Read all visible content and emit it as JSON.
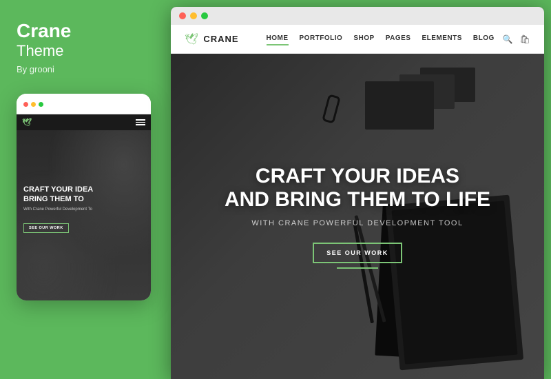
{
  "sidebar": {
    "title": "Crane",
    "subtitle": "Theme",
    "by": "By grooni"
  },
  "mobile": {
    "logo": "🕊",
    "hero_title_line1": "CRAFT YOUR IDEA",
    "hero_title_line2": "BRING THEM TO",
    "hero_sub": "With Crane Powerful Development To",
    "cta": "SEE OUR WORK"
  },
  "desktop": {
    "logo_text": "CRANE",
    "nav": {
      "items": [
        {
          "label": "HOME",
          "active": true
        },
        {
          "label": "PORTFOLIO",
          "active": false
        },
        {
          "label": "SHOP",
          "active": false
        },
        {
          "label": "PAGES",
          "active": false
        },
        {
          "label": "ELEMENTS",
          "active": false
        },
        {
          "label": "BLOG",
          "active": false
        }
      ]
    },
    "hero": {
      "title_line1": "CRAFT YOUR IDEAS",
      "title_line2": "AND BRING THEM TO LIFE",
      "subtitle": "With Crane Powerful Development Tool",
      "cta": "SEE OUR WORK"
    }
  },
  "icons": {
    "crane_logo": "🕊",
    "search": "🔍",
    "cart": "🛒"
  }
}
